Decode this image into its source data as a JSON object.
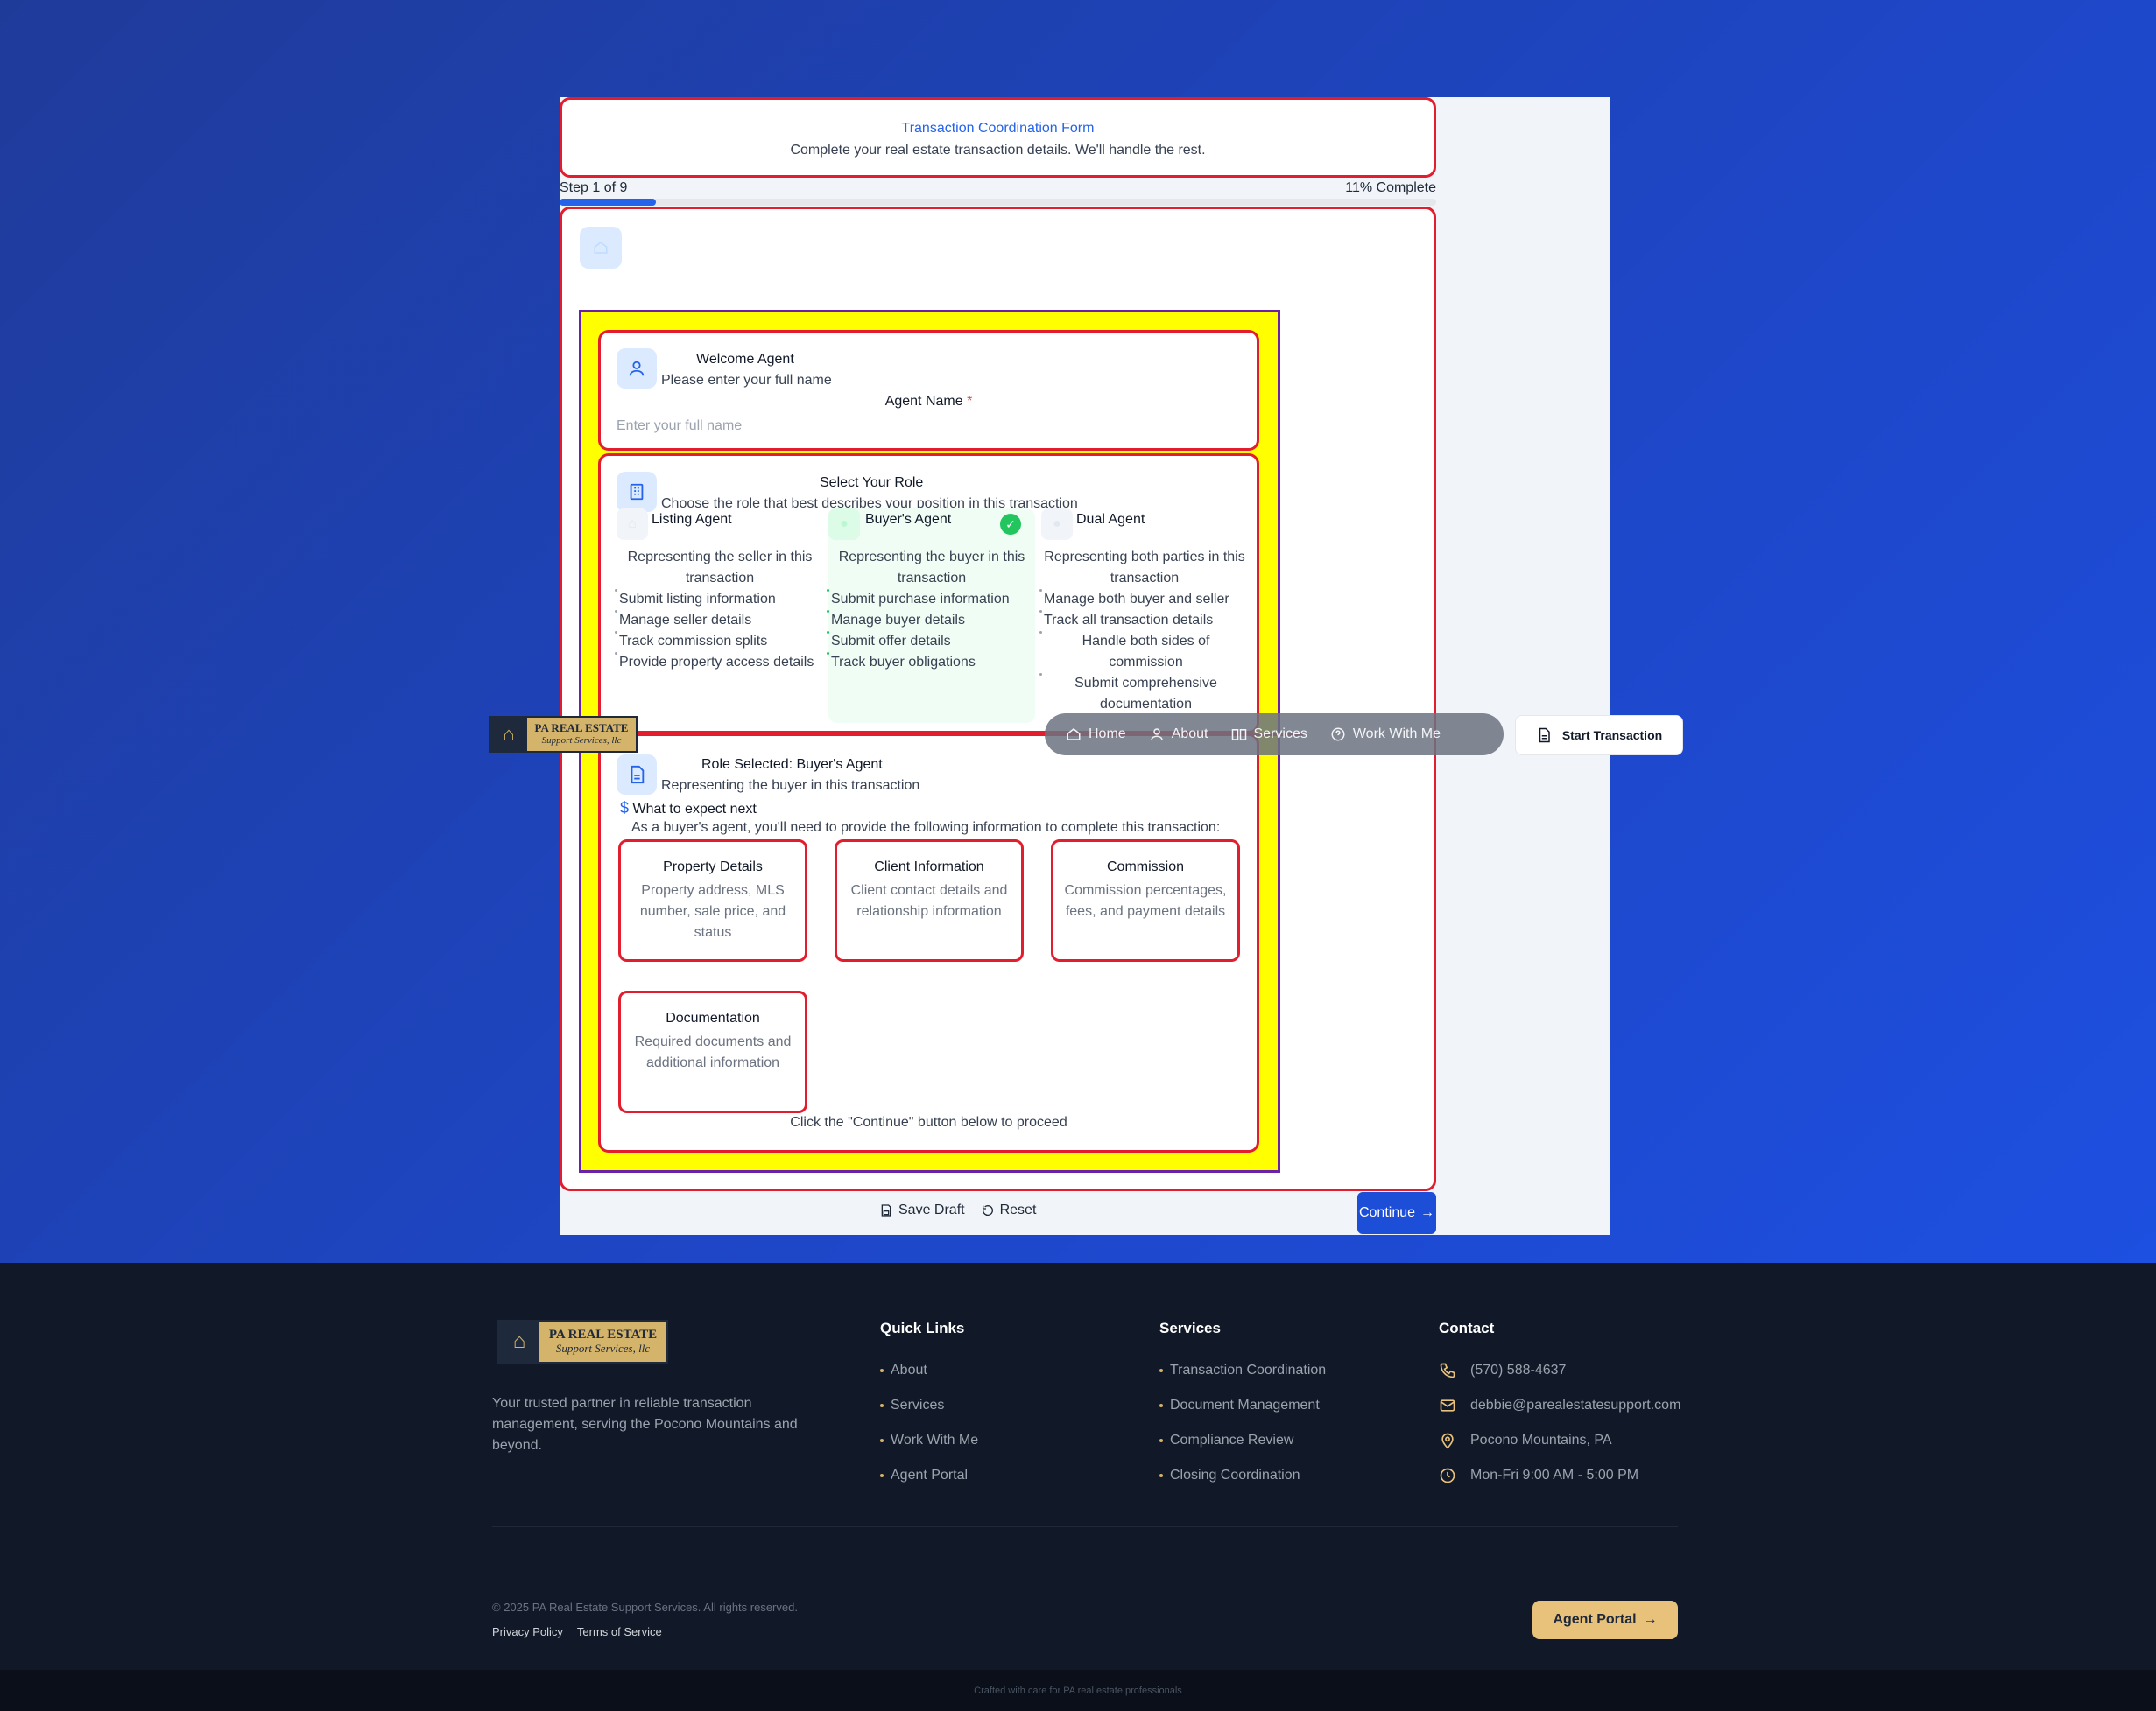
{
  "form": {
    "title": "Transaction Coordination Form",
    "subtitle": "Complete your real estate transaction details. We'll handle the rest.",
    "step_label": "Step 1 of 9",
    "percent_label": "11% Complete",
    "progress_fraction": 0.11
  },
  "welcome": {
    "title": "Welcome Agent",
    "subtitle": "Please enter your full name",
    "field_label": "Agent Name",
    "required_mark": "*",
    "placeholder": "Enter your full name",
    "value": ""
  },
  "role": {
    "title": "Select Your Role",
    "subtitle": "Choose the role that best describes your position in this transaction",
    "options": [
      {
        "name": "Listing Agent",
        "desc": "Representing the seller in this transaction",
        "features": [
          "Submit listing information",
          "Manage seller details",
          "Track commission splits",
          "Provide property access details"
        ],
        "selected": false
      },
      {
        "name": "Buyer's Agent",
        "desc": "Representing the buyer in this transaction",
        "features": [
          "Submit purchase information",
          "Manage buyer details",
          "Submit offer details",
          "Track buyer obligations"
        ],
        "selected": true
      },
      {
        "name": "Dual Agent",
        "desc": "Representing both parties in this transaction",
        "features": [
          "Manage both buyer and seller",
          "Track all transaction details",
          "Handle both sides of commission",
          "Submit comprehensive documentation"
        ],
        "selected": false
      }
    ]
  },
  "selected": {
    "title": "Role Selected: Buyer's Agent",
    "subtitle": "Representing the buyer in this transaction",
    "expect_title": "What to expect next",
    "expect_desc": "As a buyer's agent, you'll need to provide the following information to complete this transaction:",
    "cards": [
      {
        "title": "Property Details",
        "desc": "Property address, MLS number, sale price, and status"
      },
      {
        "title": "Client Information",
        "desc": "Client contact details and relationship information"
      },
      {
        "title": "Commission",
        "desc": "Commission percentages, fees, and payment details"
      },
      {
        "title": "Documentation",
        "desc": "Required documents and additional information"
      }
    ],
    "hint": "Click the \"Continue\" button below to proceed"
  },
  "actions": {
    "save_draft": "Save Draft",
    "reset": "Reset",
    "continue": "Continue"
  },
  "nav": {
    "logo_line1": "PA REAL ESTATE",
    "logo_line2": "Support Services, llc",
    "home": "Home",
    "about": "About",
    "services": "Services",
    "work": "Work With Me",
    "start": "Start Transaction"
  },
  "footer": {
    "tagline": "Your trusted partner in reliable transaction management, serving the Pocono Mountains and beyond.",
    "quick_links_title": "Quick Links",
    "quick_links": [
      "About",
      "Services",
      "Work With Me",
      "Agent Portal"
    ],
    "services_title": "Services",
    "services": [
      "Transaction Coordination",
      "Document Management",
      "Compliance Review",
      "Closing Coordination"
    ],
    "contact_title": "Contact",
    "phone": "(570) 588-4637",
    "email": "debbie@parealestatesupport.com",
    "location": "Pocono Mountains, PA",
    "hours": "Mon-Fri 9:00 AM - 5:00 PM",
    "copyright": "© 2025 PA Real Estate Support Services. All rights reserved.",
    "privacy": "Privacy Policy",
    "terms": "Terms of Service",
    "agent_portal": "Agent Portal",
    "crafted": "Crafted with care for PA real estate professionals"
  },
  "colors": {
    "accent": "#2563eb",
    "outline": "#e11d2e",
    "highlight": "#ffff00",
    "gold": "#e8c27a",
    "success": "#22c55e"
  }
}
